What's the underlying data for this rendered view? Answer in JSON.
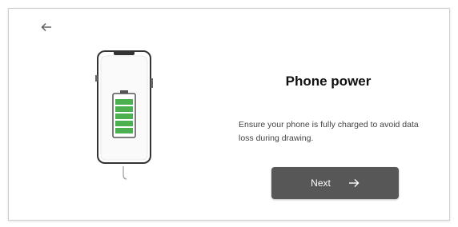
{
  "header": {
    "back_icon": "arrow-left-icon"
  },
  "illustration": {
    "icon": "phone-battery-icon",
    "battery_color": "#4caf50"
  },
  "content": {
    "title": "Phone power",
    "description": "Ensure your phone is fully charged to avoid data loss during drawing."
  },
  "actions": {
    "next_label": "Next",
    "next_icon": "arrow-right-icon",
    "button_color": "#575757"
  }
}
